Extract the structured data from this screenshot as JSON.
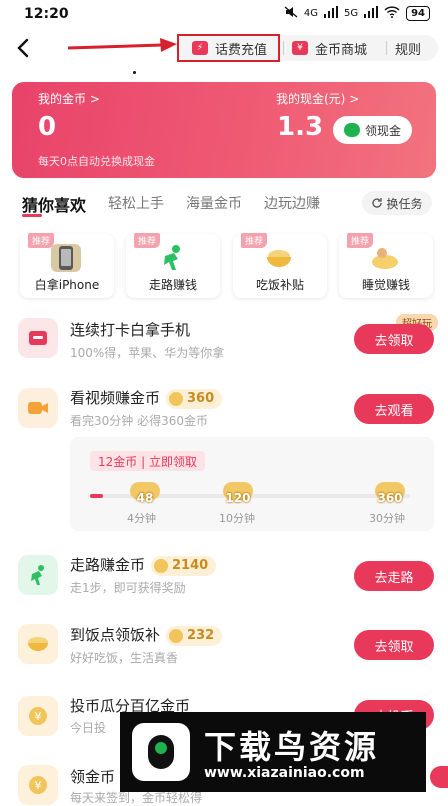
{
  "status": {
    "time": "12:20",
    "signal1": "4G",
    "signal2": "5G",
    "battery": "94"
  },
  "topbar": {
    "recharge_label": "话费充值",
    "recharge_icon": "bolt-icon",
    "store_label": "金币商城",
    "store_icon": "yen-icon",
    "rules_label": "规则"
  },
  "wallet": {
    "coins_label": "我的金币",
    "coins_value": "0",
    "cash_label": "我的现金(元)",
    "cash_value": "1.3",
    "withdraw_label": "领现金",
    "auto_note": "每天0点自动兑换成现金",
    "chevron": ">"
  },
  "tabs": [
    "猜你喜欢",
    "轻松上手",
    "海量金币",
    "边玩边赚"
  ],
  "swap_label": "换任务",
  "features": [
    {
      "badge": "推荐",
      "label": "白拿iPhone",
      "icon": "phone-icon"
    },
    {
      "badge": "推荐",
      "label": "走路赚钱",
      "icon": "walking-icon"
    },
    {
      "badge": "推荐",
      "label": "吃饭补贴",
      "icon": "food-bowl-icon"
    },
    {
      "badge": "推荐",
      "label": "睡觉赚钱",
      "icon": "sleeping-icon"
    }
  ],
  "tasks": [
    {
      "title": "连续打卡白拿手机",
      "sub": "100%得，苹果、华为等你拿",
      "button": "去领取",
      "badge": "超好玩",
      "coins": ""
    },
    {
      "title": "看视频赚金币",
      "sub": "看完30分钟 必得360金币",
      "button": "去观看",
      "coins": "360"
    },
    {
      "title": "走路赚金币",
      "sub": "走1步，即可获得奖励",
      "button": "去走路",
      "coins": "2140"
    },
    {
      "title": "到饭点领饭补",
      "sub": "好好吃饭，生活真香",
      "button": "去领取",
      "coins": "232"
    },
    {
      "title": "投币瓜分百亿金币",
      "sub": "今日投",
      "button": "去投币"
    },
    {
      "title": "领金币",
      "sub": "每天来签到，金币轻松得"
    }
  ],
  "progress": {
    "tag": "12金币 | 立即领取",
    "fraction": 0.04,
    "milestones": [
      {
        "coins": "48",
        "label": "4分钟"
      },
      {
        "coins": "120",
        "label": "10分钟"
      },
      {
        "coins": "360",
        "label": "30分钟"
      }
    ]
  },
  "watermark": {
    "title": "下载鸟资源",
    "url": "www.xiazainiao.com"
  },
  "colors": {
    "accent": "#e8395a",
    "wallet_start": "#e8436a",
    "coin_gold": "#f1c55b",
    "annotation_red": "#d8202c"
  }
}
